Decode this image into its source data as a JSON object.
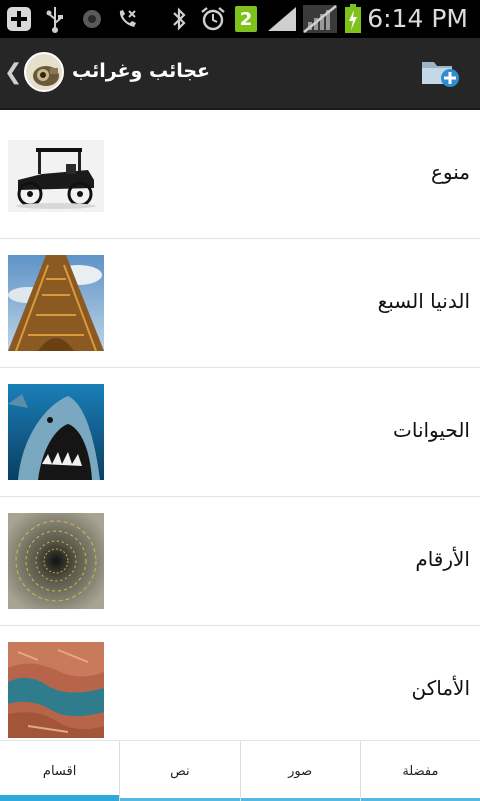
{
  "status_bar": {
    "time": "6:14 PM",
    "notification_count": "2",
    "icons": [
      "add-icon",
      "usb-icon",
      "record-icon",
      "missed-call-icon",
      "bluetooth-icon",
      "alarm-icon",
      "sim-count-icon",
      "signal-icon",
      "no-signal-icon",
      "battery-charging-icon"
    ]
  },
  "header": {
    "title": "عجائب وغرائب",
    "back_icon": "chevron-left-icon",
    "action_icon": "add-folder-icon"
  },
  "categories": [
    {
      "label": "منوع",
      "thumb": "vintage-car"
    },
    {
      "label": "الدنيا السبع",
      "thumb": "eiffel-tower"
    },
    {
      "label": "الحيوانات",
      "thumb": "shark"
    },
    {
      "label": "الأرقام",
      "thumb": "numbers-spiral"
    },
    {
      "label": "الأماكن",
      "thumb": "canyon-lake"
    }
  ],
  "tabs": [
    {
      "label": "مفضلة",
      "active": false
    },
    {
      "label": "صور",
      "active": false
    },
    {
      "label": "نص",
      "active": false
    },
    {
      "label": "اقسام",
      "active": true
    }
  ],
  "colors": {
    "action_bar": "#262626",
    "tab_indicator": "#2fa8dc",
    "status_bar": "#000000"
  }
}
